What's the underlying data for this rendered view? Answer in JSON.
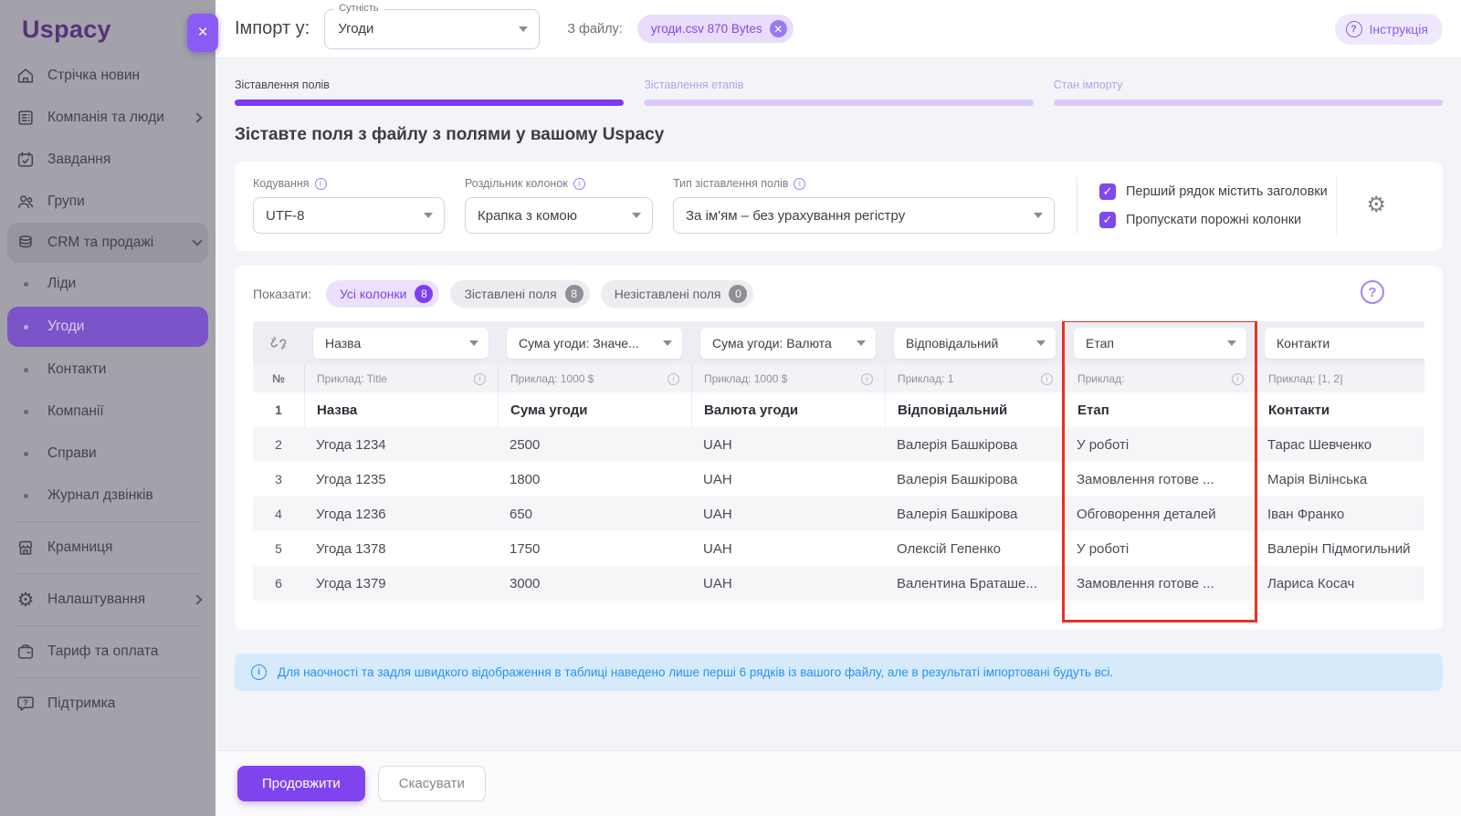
{
  "sidebar": {
    "logo": "Uspacy",
    "close": "×",
    "items": [
      {
        "label": "Стрічка новин"
      },
      {
        "label": "Компанія та люди"
      },
      {
        "label": "Завдання"
      },
      {
        "label": "Групи"
      },
      {
        "label": "CRM та продажі"
      },
      {
        "label": "Ліди"
      },
      {
        "label": "Угоди"
      },
      {
        "label": "Контакти"
      },
      {
        "label": "Компанії"
      },
      {
        "label": "Справи"
      },
      {
        "label": "Журнал дзвінків"
      },
      {
        "label": "Крамниця"
      },
      {
        "label": "Налаштування"
      },
      {
        "label": "Тариф та оплата"
      },
      {
        "label": "Підтримка"
      }
    ]
  },
  "header": {
    "title": "Імпорт у:",
    "entity_label": "Сутність",
    "entity_value": "Угоди",
    "file_label": "З файлу:",
    "file_chip": "угоди.csv 870 Bytes",
    "instruction_label": "Інструкція"
  },
  "steps": [
    {
      "label": "Зіставлення полів"
    },
    {
      "label": "Зіставлення етапів"
    },
    {
      "label": "Стан імпорту"
    }
  ],
  "heading": "Зіставте поля з файлу з полями у вашому Uspacy",
  "settings": {
    "encoding_label": "Кодування",
    "encoding_value": "UTF-8",
    "delimiter_label": "Роздільник колонок",
    "delimiter_value": "Крапка з комою",
    "match_type_label": "Тип зіставлення полів",
    "match_type_value": "За ім'ям – без урахування регістру",
    "checkbox_headers": "Перший рядок містить заголовки",
    "checkbox_skip": "Пропускати порожні колонки"
  },
  "filters": {
    "label": "Показати:",
    "chips": [
      {
        "label": "Усі колонки",
        "count": "8"
      },
      {
        "label": "Зіставлені поля",
        "count": "8"
      },
      {
        "label": "Незіставлені поля",
        "count": "0"
      }
    ]
  },
  "table": {
    "selects": [
      "Назва",
      "Сума угоди: Значе...",
      "Сума угоди: Валюта",
      "Відповідальний",
      "Етап",
      "Контакти"
    ],
    "example": {
      "num": "№",
      "cells": [
        "Приклад: Title",
        "Приклад: 1000 $",
        "Приклад: 1000 $",
        "Приклад: 1",
        "Приклад:",
        "Приклад: [1, 2]"
      ]
    },
    "rows": [
      {
        "num": "1",
        "cells": [
          "Назва",
          "Сума угоди",
          "Валюта угоди",
          "Відповідальний",
          "Етап",
          "Контакти"
        ]
      },
      {
        "num": "2",
        "cells": [
          "Угода 1234",
          "2500",
          "UAH",
          "Валерія Башкірова",
          "У роботі",
          "Тарас Шевченко"
        ]
      },
      {
        "num": "3",
        "cells": [
          "Угода 1235",
          "1800",
          "UAH",
          "Валерія Башкірова",
          "Замовлення готове ...",
          "Марія Вілінська"
        ]
      },
      {
        "num": "4",
        "cells": [
          "Угода 1236",
          "650",
          "UAH",
          "Валерія Башкірова",
          "Обговорення деталей",
          "Іван Франко"
        ]
      },
      {
        "num": "5",
        "cells": [
          "Угода 1378",
          "1750",
          "UAH",
          "Олексій Гепенко",
          "У роботі",
          "Валерін Підмогильний"
        ]
      },
      {
        "num": "6",
        "cells": [
          "Угода 1379",
          "3000",
          "UAH",
          "Валентина Браташе...",
          "Замовлення готове ...",
          "Лариса Косач"
        ]
      }
    ]
  },
  "info_message": "Для наочності та задля швидкого відображення в таблиці наведено лише перші 6 рядків із вашого файлу, але в результаті імпортовані будуть всі.",
  "footer": {
    "continue_label": "Продовжити",
    "cancel_label": "Скасувати"
  },
  "colors": {
    "accent_purple": "#8044ef",
    "light_purple_chip": "#e9ddfc",
    "step_active_bar": "#7d3bf3",
    "highlight_red": "#e93123",
    "info_blue": "#2492f0",
    "selected_nav": "#7a54c8"
  }
}
